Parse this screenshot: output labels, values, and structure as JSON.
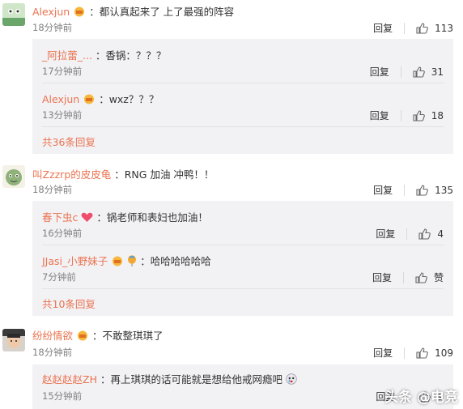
{
  "comments": [
    {
      "username": "Alexjun",
      "text": "：都认真起来了 上了最强的阵容",
      "time": "18分钟前",
      "reply_label": "回复",
      "likes": "113",
      "replies": [
        {
          "username": "_阿拉蕾_...",
          "text": "：香锅：？？？",
          "time": "17分钟前",
          "reply_label": "回复",
          "likes": "31"
        },
        {
          "username": "Alexjun",
          "text": "：wxz？？？",
          "time": "13分钟前",
          "reply_label": "回复",
          "likes": "18"
        }
      ],
      "more": "共36条回复"
    },
    {
      "username": "叫Zzzrp的皮皮龟",
      "text": "：RNG 加油 冲鸭！！",
      "time": "18分钟前",
      "reply_label": "回复",
      "likes": "135",
      "replies": [
        {
          "username": "春下虫c",
          "text": "：锅老师和表妇也加油！",
          "time": "16分钟前",
          "reply_label": "回复",
          "likes": "4"
        },
        {
          "username": "JJasi_小野妹子",
          "text": "：哈哈哈哈哈哈",
          "time": "7分钟前",
          "reply_label": "回复",
          "likes": "赞"
        }
      ],
      "more": "共10条回复"
    },
    {
      "username": "纷纷情欲",
      "text": "：不敢整琪琪了",
      "time": "18分钟前",
      "reply_label": "回复",
      "likes": "109",
      "replies": [
        {
          "username": "赵赵赵赵ZH",
          "text": "：再上琪琪的话可能就是想给他戒网瘾吧",
          "time": "15分钟前",
          "reply_label": "回复",
          "likes": "9"
        }
      ]
    }
  ],
  "watermark": "头条 @电竞",
  "colors": {
    "username": "#eb7350",
    "reply_bg": "#f2f2f5",
    "time": "#808080"
  },
  "icons": {
    "like": "thumbs-up-icon",
    "badge": "vip-badge-icon"
  }
}
